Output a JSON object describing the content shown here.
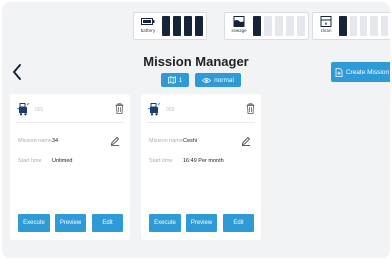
{
  "status": {
    "battery": {
      "label": "battery",
      "icon": "battery-icon",
      "filled": 4,
      "total": 4
    },
    "sewage": {
      "label": "sewage",
      "icon": "sewage-tank-icon",
      "filled": 1,
      "total": 5
    },
    "clean": {
      "label": "clean",
      "icon": "clean-water-tank-icon",
      "filled": 1,
      "total": 5
    }
  },
  "header": {
    "title": "Mission Manager",
    "map_chip": "1",
    "mode_chip": "normal",
    "create_label": "Create Mission"
  },
  "missions": [
    {
      "id_text": "001",
      "name_label": "Mission name",
      "name_value": "34",
      "start_label": "Start time",
      "start_value": "Untimed",
      "buttons": [
        "Execute",
        "Preview",
        "Edit"
      ]
    },
    {
      "id_text": "003",
      "name_label": "Mission name",
      "name_value": "Ceshi",
      "start_label": "Start time",
      "start_value": "16:49 Per month",
      "buttons": [
        "Execute",
        "Preview",
        "Edit"
      ]
    }
  ],
  "colors": {
    "accent": "#2f9bd6",
    "bar_on": "#16243a",
    "bar_off": "#e4e7ec",
    "background": "#f2f3f5"
  }
}
